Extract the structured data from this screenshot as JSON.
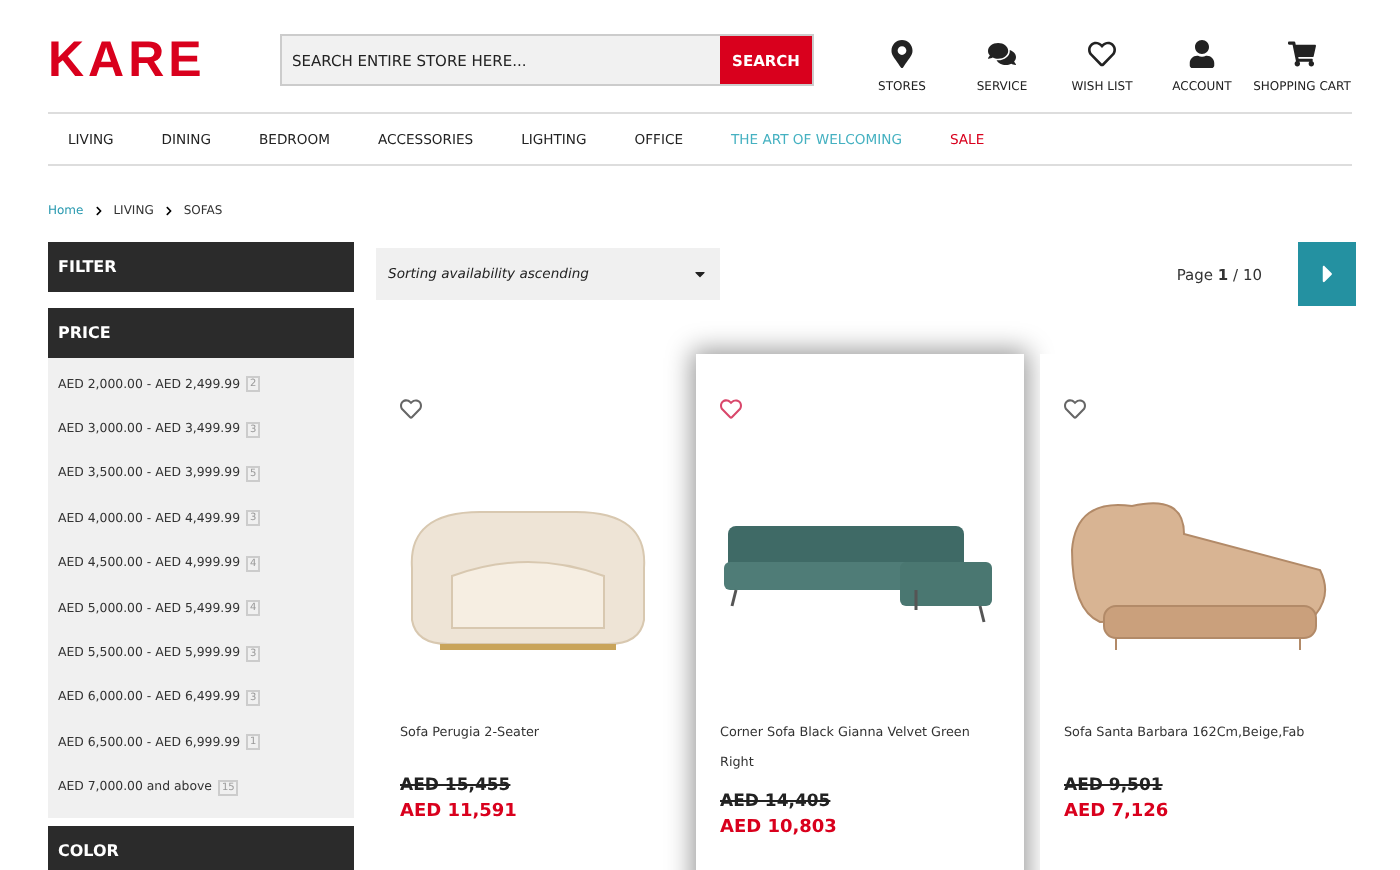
{
  "logo": "KARE",
  "search": {
    "placeholder": "SEARCH ENTIRE STORE HERE...",
    "button": "SEARCH"
  },
  "header_links": [
    {
      "kind": "pin",
      "label": "STORES"
    },
    {
      "kind": "chat",
      "label": "SERVICE"
    },
    {
      "kind": "heart",
      "label": "WISH LIST"
    },
    {
      "kind": "person",
      "label": "ACCOUNT"
    },
    {
      "kind": "cart",
      "label": "SHOPPING CART"
    }
  ],
  "nav": [
    {
      "label": "LIVING",
      "kind": "normal"
    },
    {
      "label": "DINING",
      "kind": "normal"
    },
    {
      "label": "BEDROOM",
      "kind": "normal"
    },
    {
      "label": "ACCESSORIES",
      "kind": "normal"
    },
    {
      "label": "LIGHTING",
      "kind": "normal"
    },
    {
      "label": "OFFICE",
      "kind": "normal"
    },
    {
      "label": "THE ART OF WELCOMING",
      "kind": "feature"
    },
    {
      "label": "SALE",
      "kind": "sale"
    }
  ],
  "breadcrumb": [
    "Home",
    "LIVING",
    "SOFAS"
  ],
  "sidebar": {
    "filter_title": "FILTER",
    "price_title": "PRICE",
    "next_title": "COLOR",
    "price_ranges": [
      {
        "label": "AED 2,000.00 - AED 2,499.99",
        "count": "2"
      },
      {
        "label": "AED 3,000.00 - AED 3,499.99",
        "count": "3"
      },
      {
        "label": "AED 3,500.00 - AED 3,999.99",
        "count": "5"
      },
      {
        "label": "AED 4,000.00 - AED 4,499.99",
        "count": "3"
      },
      {
        "label": "AED 4,500.00 - AED 4,999.99",
        "count": "4"
      },
      {
        "label": "AED 5,000.00 - AED 5,499.99",
        "count": "4"
      },
      {
        "label": "AED 5,500.00 - AED 5,999.99",
        "count": "3"
      },
      {
        "label": "AED 6,000.00 - AED 6,499.99",
        "count": "3"
      },
      {
        "label": "AED 6,500.00 - AED 6,999.99",
        "count": "1"
      },
      {
        "label": "AED 7,000.00 and above",
        "count": "15"
      }
    ]
  },
  "sorting": {
    "value": "Sorting availability ascending"
  },
  "pager": {
    "label": "Page",
    "current": "1",
    "total": "/ 10"
  },
  "products": [
    {
      "kind": "round",
      "name": "Sofa Perugia 2-Seater",
      "old_price": "AED 15,455",
      "price": "AED 11,591",
      "selected": false
    },
    {
      "kind": "corner",
      "name": "Corner Sofa Black Gianna Velvet Green Right",
      "old_price": "AED 14,405",
      "price": "AED 10,803",
      "selected": true
    },
    {
      "kind": "chaise",
      "name": "Sofa Santa Barbara 162Cm,Beige,Fab",
      "old_price": "AED 9,501",
      "price": "AED 7,126",
      "selected": false
    }
  ]
}
